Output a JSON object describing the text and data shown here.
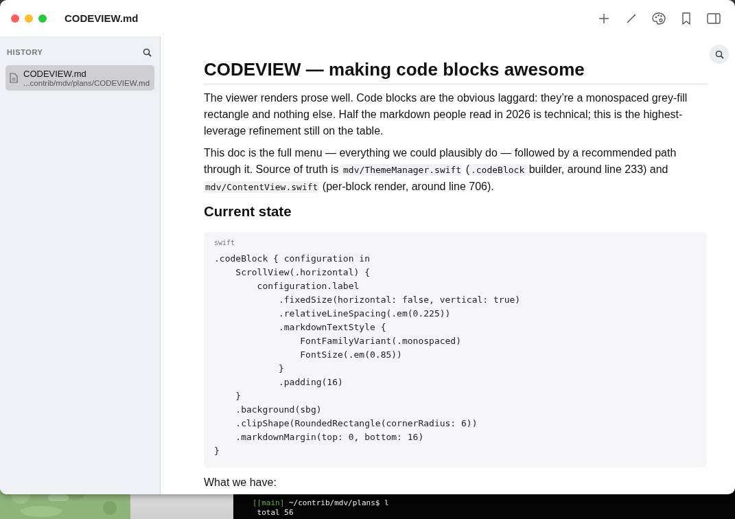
{
  "window": {
    "title": "CODEVIEW.md"
  },
  "sidebar": {
    "heading": "HISTORY",
    "items": [
      {
        "name": "CODEVIEW.md",
        "path": "...contrib/mdv/plans/CODEVIEW.md",
        "selected": true
      }
    ]
  },
  "document": {
    "title": "CODEVIEW — making code blocks awesome",
    "paragraphs": [
      [
        {
          "text": "The viewer renders prose well. Code blocks are the obvious laggard: they’re a monospaced grey-fill rectangle and nothing else. Half the markdown people read in 2026 is technical; this is the highest-leverage refinement still on the table.",
          "code": false
        }
      ],
      [
        {
          "text": "This doc is the full menu — everything we could plausibly do — followed by a recommended path through it. Source of truth is ",
          "code": false
        },
        {
          "text": "mdv/ThemeManager.swift",
          "code": true
        },
        {
          "text": " (",
          "code": false
        },
        {
          "text": ".codeBlock",
          "code": true
        },
        {
          "text": " builder, around line 233) and ",
          "code": false
        },
        {
          "text": "mdv/ContentView.swift",
          "code": true
        },
        {
          "text": " (per-block render, around line 706).",
          "code": false
        }
      ]
    ],
    "section": "Current state",
    "code_block": {
      "language": "swift",
      "lines": [
        ".codeBlock { configuration in",
        "    ScrollView(.horizontal) {",
        "        configuration.label",
        "            .fixedSize(horizontal: false, vertical: true)",
        "            .relativeLineSpacing(.em(0.225))",
        "            .markdownTextStyle {",
        "                FontFamilyVariant(.monospaced)",
        "                FontSize(.em(0.85))",
        "            }",
        "            .padding(16)",
        "    }",
        "    .background(sbg)",
        "    .clipShape(RoundedRectangle(cornerRadius: 6))",
        "    .markdownMargin(top: 0, bottom: 16)",
        "}"
      ]
    },
    "after": "What we have:"
  },
  "terminal": {
    "lines": [
      {
        "prompt": "[[main]",
        "text": " ~/contrib/mdv/plans$ l"
      },
      {
        "text": " total 56"
      }
    ]
  }
}
